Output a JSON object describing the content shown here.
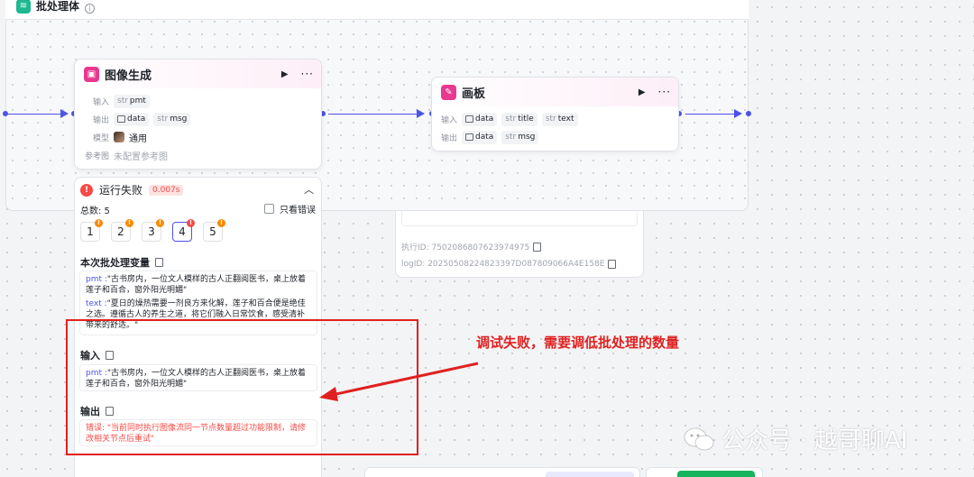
{
  "batch": {
    "title": "批处理体"
  },
  "image_node": {
    "title": "图像生成",
    "input_label": "输入",
    "input_chip": {
      "type": "str",
      "name": "pmt"
    },
    "output_label": "输出",
    "output_chips": [
      {
        "type": "img",
        "name": "data"
      },
      {
        "type": "str",
        "name": "msg"
      }
    ],
    "model_label": "模型",
    "model_value": "通用",
    "ref_label": "参考图",
    "ref_value": "未配置参考图"
  },
  "canvas_node": {
    "title": "画板",
    "input_label": "输入",
    "input_chips": [
      {
        "type": "img",
        "name": "data"
      },
      {
        "type": "str",
        "name": "title"
      },
      {
        "type": "str",
        "name": "text"
      }
    ],
    "output_label": "输出",
    "output_chips": [
      {
        "type": "img",
        "name": "data"
      },
      {
        "type": "str",
        "name": "msg"
      }
    ]
  },
  "run_panel": {
    "status": "运行失败",
    "duration": "0.007s",
    "total": "总数: 5",
    "only_errors": "只看错误",
    "items": [
      "1",
      "2",
      "3",
      "4",
      "5"
    ],
    "batch_vars_title": "本次批处理变量",
    "batch_vars": {
      "pmt_key": "pmt :",
      "pmt_val": "\"古书房内，一位文人模样的古人正翻阅医书，桌上放着莲子和百合，窗外阳光明媚\"",
      "text_key": "text :",
      "text_val": "\"夏日的燥热需要一剂良方来化解，莲子和百合便是绝佳之选。遵循古人的养生之道，将它们融入日常饮食，感受清补带来的舒适。\""
    },
    "input_title": "输入",
    "input_pmt_key": "pmt :",
    "input_pmt_val": "\"古书房内，一位文人模样的古人正翻阅医书，桌上放着莲子和百合，窗外阳光明媚\"",
    "output_title": "输出",
    "output_error": "错误: \"当前同时执行图像流同一节点数量超过功能限制，请修改相关节点后重试\""
  },
  "bg_panel": {
    "exec_id": "执行ID: 7502086807623974975",
    "log_id": "logID: 20250508224823397D087809066A4E158E"
  },
  "annotation": {
    "text": "调试失败，需要调低批处理的数量"
  },
  "watermark": {
    "text": "公众号 · 越哥聊AI"
  },
  "colors": {
    "accent": "#4d53e8",
    "error": "#f54a45",
    "annotation": "#e02020",
    "node_icon": "#e9388f",
    "batch_icon": "#1fb890"
  }
}
